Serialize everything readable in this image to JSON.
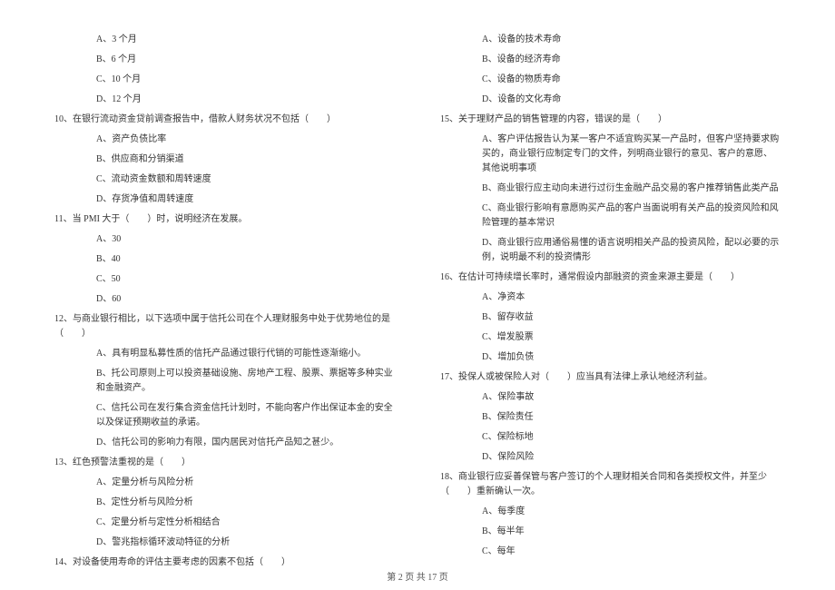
{
  "left_column": {
    "q9_options": [
      "A、3 个月",
      "B、6 个月",
      "C、10 个月",
      "D、12 个月"
    ],
    "q10": {
      "stem": "10、在银行流动资金贷前调查报告中，借款人财务状况不包括（　　）",
      "options": [
        "A、资产负债比率",
        "B、供应商和分销渠道",
        "C、流动资金数额和周转速度",
        "D、存货净值和周转速度"
      ]
    },
    "q11": {
      "stem": "11、当 PMI 大于（　　）时，说明经济在发展。",
      "options": [
        "A、30",
        "B、40",
        "C、50",
        "D、60"
      ]
    },
    "q12": {
      "stem": "12、与商业银行相比，以下选项中属于信托公司在个人理财服务中处于优势地位的是（　　）",
      "options": [
        "A、具有明显私募性质的信托产品通过银行代销的可能性逐渐缩小。",
        "B、托公司原则上可以投资基础设施、房地产工程、股票、票据等多种实业和金融资产。",
        "C、信托公司在发行集合资金信托计划时，不能向客户作出保证本金的安全以及保证预期收益的承诺。",
        "D、信托公司的影响力有限，国内居民对信托产品知之甚少。"
      ]
    },
    "q13": {
      "stem": "13、红色预警法重视的是（　　）",
      "options": [
        "A、定量分析与风险分析",
        "B、定性分析与风险分析",
        "C、定量分析与定性分析相结合",
        "D、警兆指标循环波动特征的分析"
      ]
    },
    "q14": {
      "stem": "14、对设备使用寿命的评估主要考虑的因素不包括（　　）"
    }
  },
  "right_column": {
    "q14_options": [
      "A、设备的技术寿命",
      "B、设备的经济寿命",
      "C、设备的物质寿命",
      "D、设备的文化寿命"
    ],
    "q15": {
      "stem": "15、关于理财产品的销售管理的内容，错误的是（　　）",
      "options": [
        "A、客户评估报告认为某一客户不适宜购买某一产品时，但客户坚持要求购买的，商业银行应制定专门的文件，列明商业银行的意见、客户的意愿、其他说明事项",
        "B、商业银行应主动向未进行过衍生金融产品交易的客户推荐销售此类产品",
        "C、商业银行影响有意愿购买产品的客户当面说明有关产品的投资风险和风险管理的基本常识",
        "D、商业银行应用通俗易懂的语言说明相关产品的投资风险，配以必要的示例，说明最不利的投资情形"
      ]
    },
    "q16": {
      "stem": "16、在估计可持续增长率时，通常假设内部融资的资金来源主要是（　　）",
      "options": [
        "A、净资本",
        "B、留存收益",
        "C、增发股票",
        "D、增加负债"
      ]
    },
    "q17": {
      "stem": "17、投保人或被保险人对（　　）应当具有法律上承认地经济利益。",
      "options": [
        "A、保险事故",
        "B、保险责任",
        "C、保险标地",
        "D、保险风险"
      ]
    },
    "q18": {
      "stem": "18、商业银行应妥善保管与客户签订的个人理财相关合同和各类授权文件，并至少（　　）重新确认一次。",
      "options": [
        "A、每季度",
        "B、每半年",
        "C、每年"
      ]
    }
  },
  "footer": "第 2 页 共 17 页"
}
